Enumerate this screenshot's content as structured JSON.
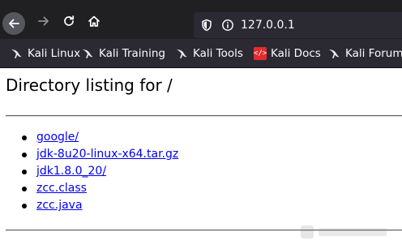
{
  "browser": {
    "url": "127.0.0.1",
    "icons": {
      "back": "arrow-left-icon",
      "forward": "arrow-right-icon",
      "reload": "reload-icon",
      "home": "home-icon",
      "shield": "shield-icon",
      "info": "info-icon"
    },
    "colors": {
      "toolbar": "#202023",
      "urlbar": "#2b2a33",
      "text": "#fbfbfe",
      "link": "#0000ee"
    }
  },
  "bookmarks": [
    {
      "label": "Kali Linux",
      "icon": "kali-dragon-icon"
    },
    {
      "label": "Kali Training",
      "icon": "kali-dragon-icon"
    },
    {
      "label": "Kali Tools",
      "icon": "kali-dragon-icon"
    },
    {
      "label": "Kali Docs",
      "icon": "kali-docs-icon"
    },
    {
      "label": "Kali Forums",
      "icon": "kali-dragon-icon"
    }
  ],
  "page": {
    "title": "Directory listing for /",
    "entries": [
      "google/",
      "jdk-8u20-linux-x64.tar.gz",
      "jdk1.8.0_20/",
      "zcc.class",
      "zcc.java"
    ]
  }
}
